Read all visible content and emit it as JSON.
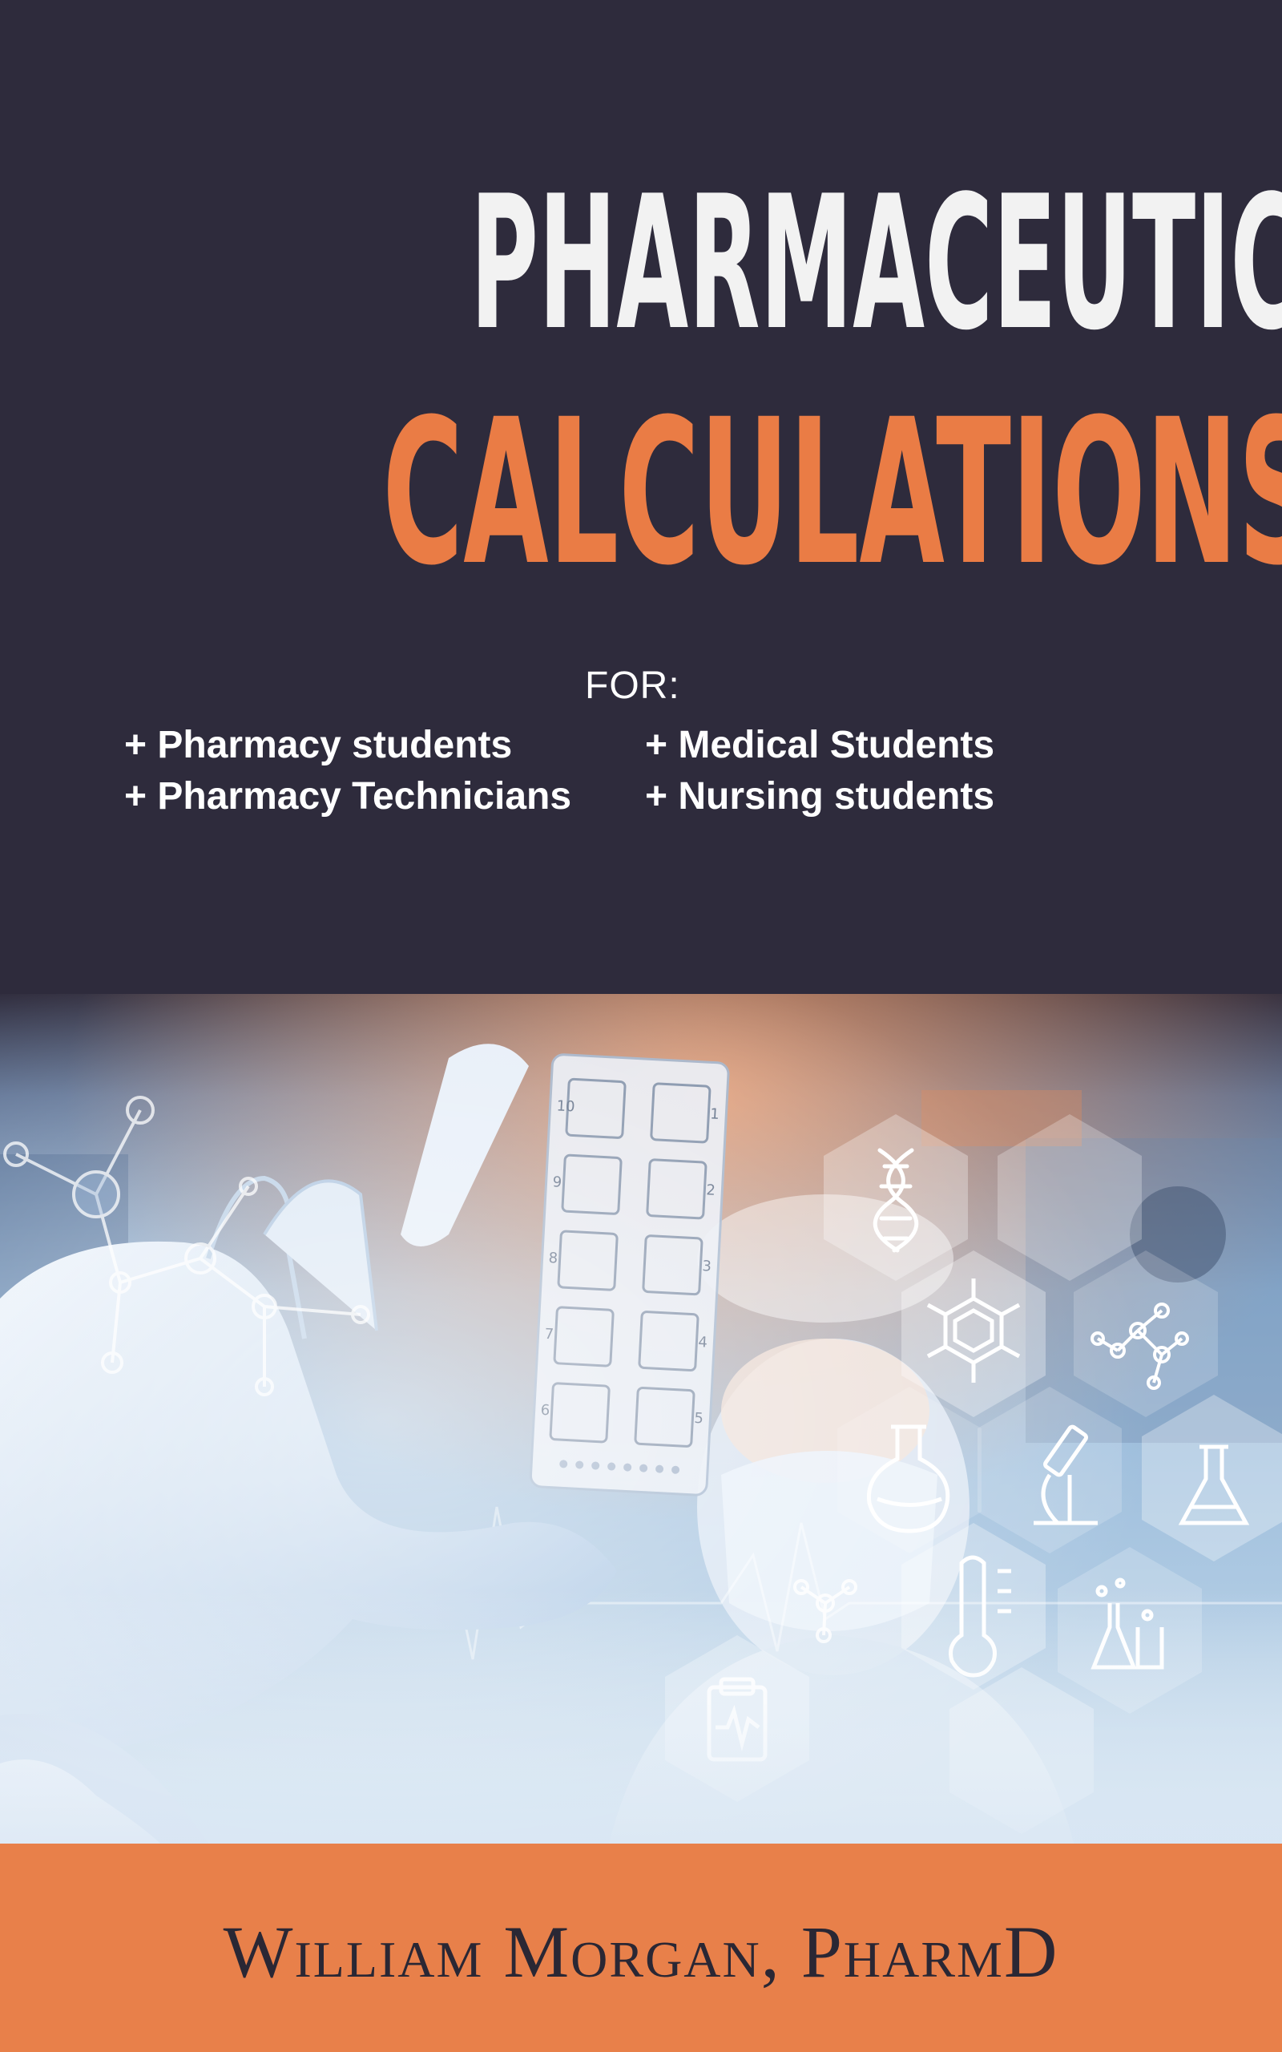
{
  "cover": {
    "title_line_1": "PHARMACEUTICAL",
    "title_line_2": "CALCULATIONS",
    "for_label": "FOR:",
    "audiences": [
      "+ Pharmacy students",
      "+ Medical Students",
      "+ Pharmacy Technicians",
      "+ Nursing students"
    ],
    "author": "William Morgan, PharmD",
    "slide_numbers": [
      "10",
      "1",
      "9",
      "2",
      "8",
      "3",
      "7",
      "4",
      "6",
      "5"
    ]
  },
  "colors": {
    "background": "#2e2b3c",
    "title_white": "#f2f2f2",
    "title_orange": "#ea7c45",
    "author_band": "#e8804a",
    "author_text": "#2a2734"
  },
  "icons": [
    "dna-icon",
    "benzene-molecule-icon",
    "molecule-icon",
    "round-flask-icon",
    "microscope-icon",
    "erlenmeyer-flask-icon",
    "thermometer-icon",
    "lab-glassware-icon",
    "clipboard-chart-icon",
    "network-molecule-icon"
  ]
}
